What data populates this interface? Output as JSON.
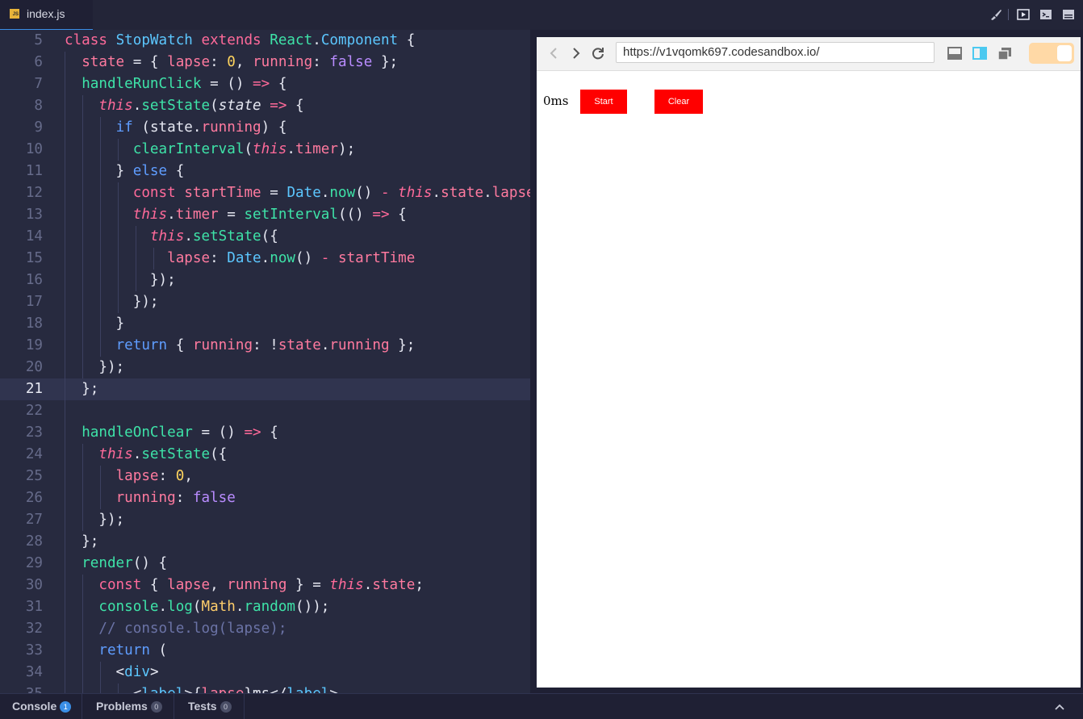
{
  "tabs": {
    "active_file": "index.js",
    "file_type": "JS"
  },
  "editor": {
    "active_line": 21
  },
  "browser": {
    "url": "https://v1vqomk697.codesandbox.io/",
    "lapse_text": "0ms",
    "start_label": "Start",
    "clear_label": "Clear"
  },
  "bottom": {
    "console_label": "Console",
    "console_count": "1",
    "problems_label": "Problems",
    "problems_count": "0",
    "tests_label": "Tests",
    "tests_count": "0"
  },
  "colors": {
    "accent": "#3a8ee6",
    "button_red": "#ff0000",
    "editor_bg": "#272a3f"
  }
}
